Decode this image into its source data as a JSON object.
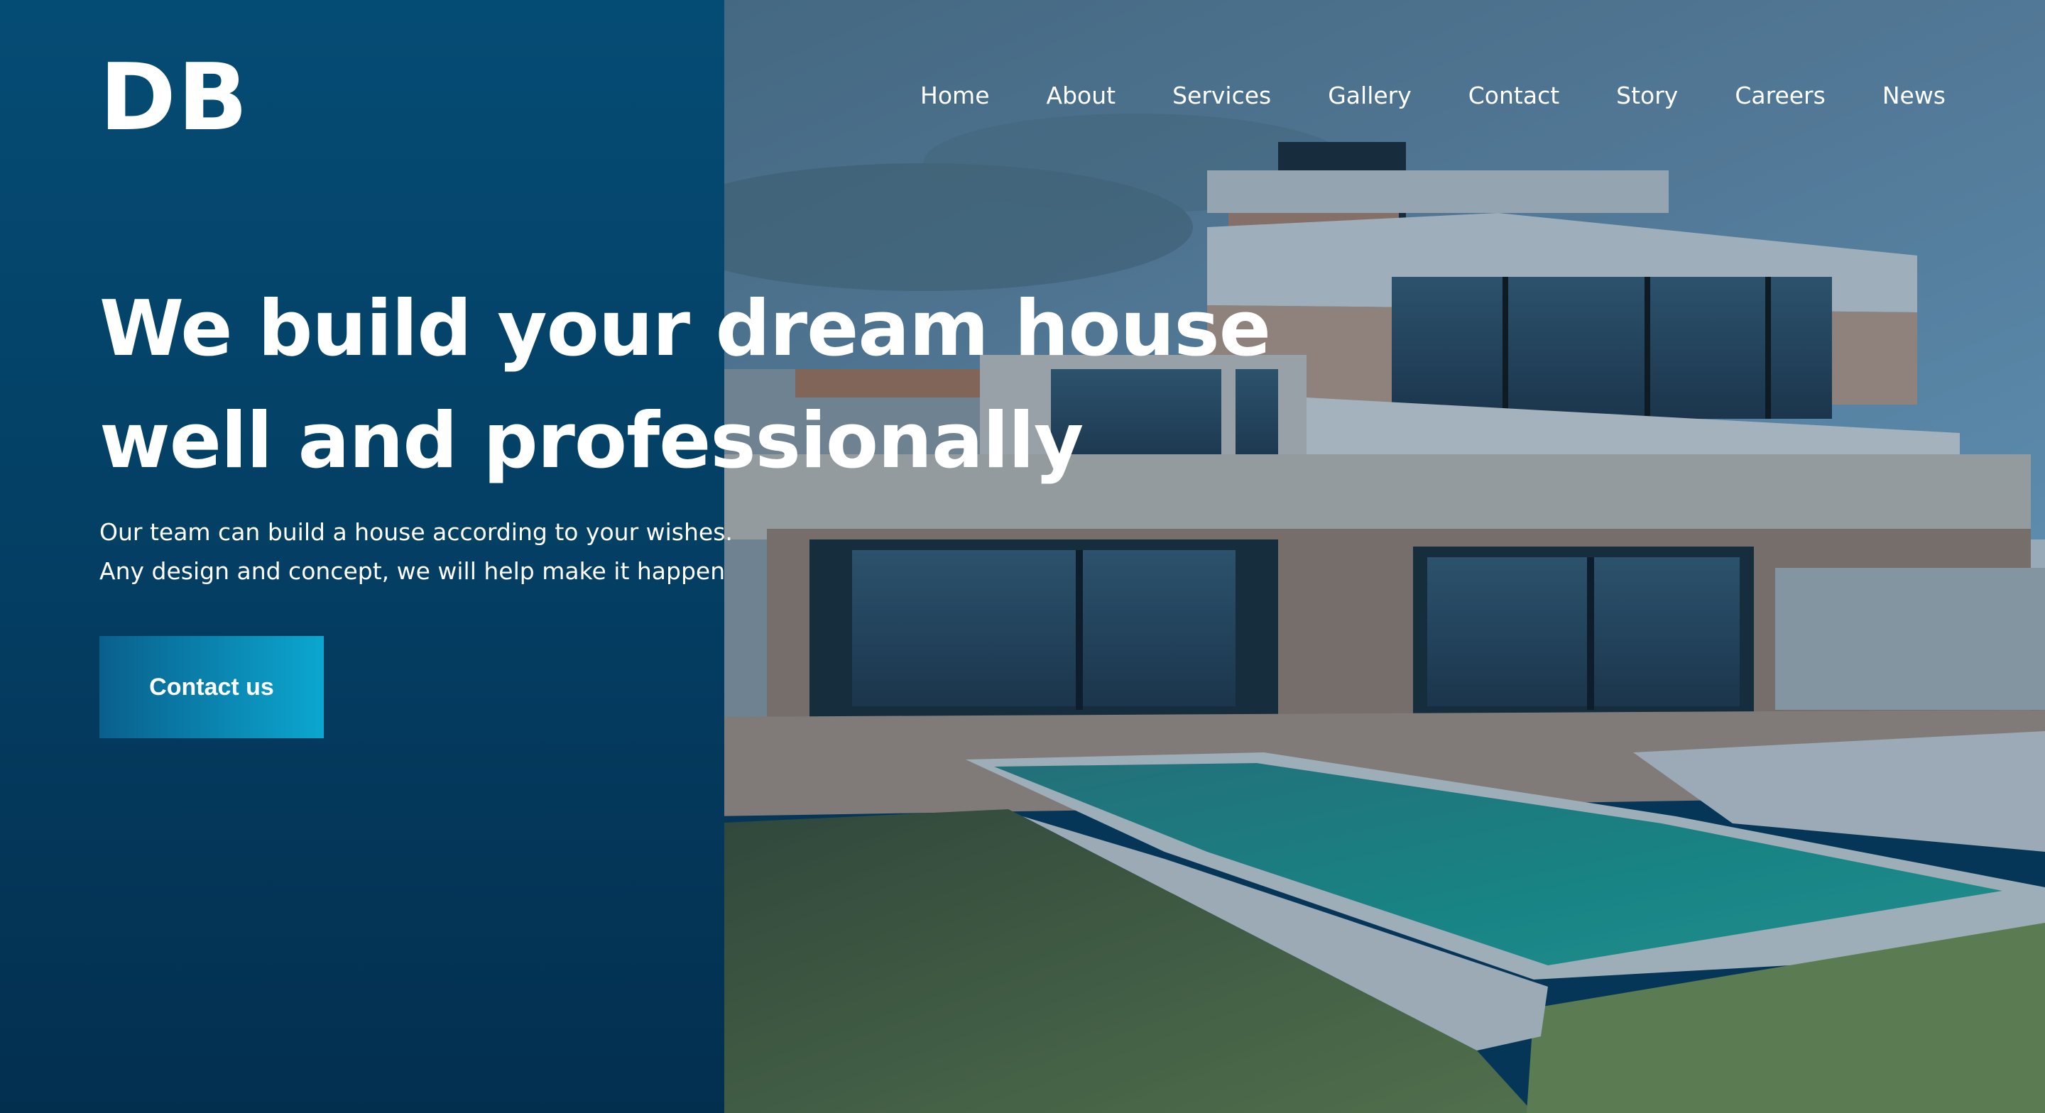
{
  "brand": {
    "logo_text": "DB"
  },
  "nav": {
    "items": [
      {
        "label": "Home"
      },
      {
        "label": "About"
      },
      {
        "label": "Services"
      },
      {
        "label": "Gallery"
      },
      {
        "label": "Contact"
      },
      {
        "label": "Story"
      },
      {
        "label": "Careers"
      },
      {
        "label": "News"
      }
    ]
  },
  "hero": {
    "headline_line1": "We build your dream house",
    "headline_line2": "well and professionally",
    "subtext_line1": "Our team can build a house according to your wishes.",
    "subtext_line2": "Any design and concept, we will help make it happen",
    "cta_label": "Contact us"
  },
  "colors": {
    "panel": "#054c74",
    "panel_dark": "#032f4f",
    "cta_start": "#0a5f8c",
    "cta_end": "#0ba7d0",
    "text": "#ffffff"
  },
  "icons": [
    "house-photo"
  ]
}
